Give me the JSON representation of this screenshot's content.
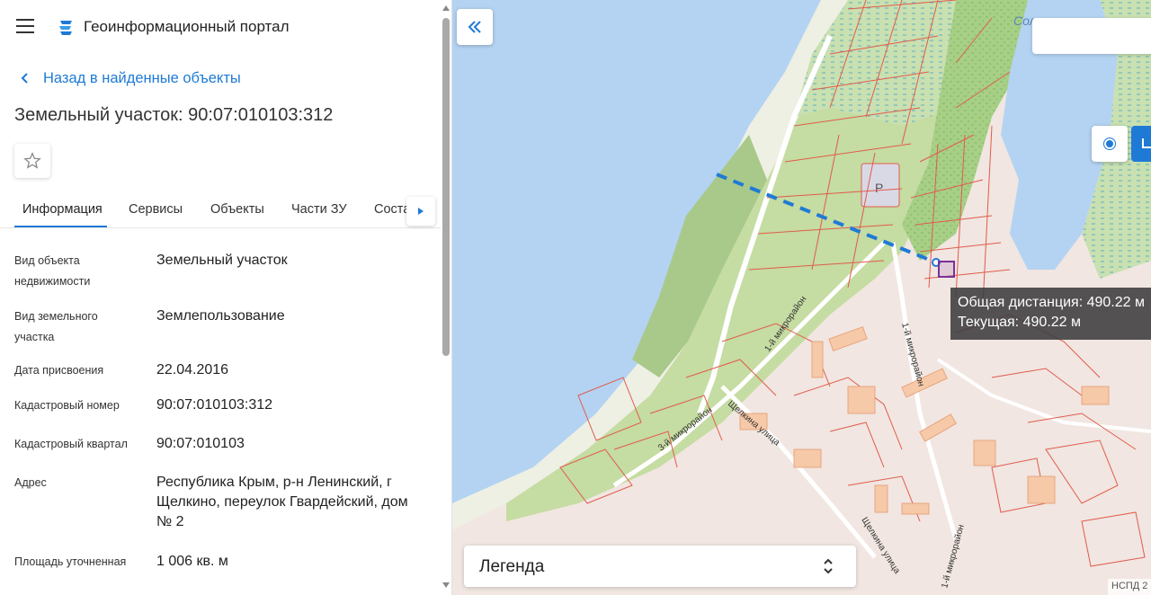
{
  "app": {
    "title": "Геоинформационный портал",
    "icons": {
      "menu": "hamburger-menu-icon",
      "logo": "portal-logo-icon"
    }
  },
  "nav": {
    "back_label": "Назад в найденные объекты"
  },
  "object": {
    "title": "Земельный участок: 90:07:010103:312"
  },
  "tabs": [
    {
      "label": "Информация",
      "active": true
    },
    {
      "label": "Сервисы"
    },
    {
      "label": "Объекты"
    },
    {
      "label": "Части ЗУ"
    },
    {
      "label": "Соста"
    }
  ],
  "properties": [
    {
      "label": "Вид объекта недвижимости",
      "value": "Земельный участок"
    },
    {
      "label": "Вид земельного участка",
      "value": "Землепользование"
    },
    {
      "label": "Дата присвоения",
      "value": "22.04.2016"
    },
    {
      "label": "Кадастровый номер",
      "value": "90:07:010103:312"
    },
    {
      "label": "Кадастровый квартал",
      "value": "90:07:010103"
    },
    {
      "label": "Адрес",
      "value": "Республика Крым, р-н Ленинский, г Щелкино, переулок Гвардейский, дом № 2"
    },
    {
      "label": "Площадь уточненная",
      "value": "1 006 кв. м"
    }
  ],
  "map": {
    "lake_label": "Сол оз",
    "parking_label": "P",
    "streets": [
      "1-й микрорайон",
      "1-й микрорайон",
      "3-й микрорайон",
      "Щелкина улица",
      "Щелкина улица",
      "1-й микрорайон"
    ],
    "measure": {
      "total": "Общая дистанция: 490.22 м",
      "current": "Текущая: 490.22 м"
    },
    "legend_label": "Легенда",
    "attribution": "НСПД 2",
    "colors": {
      "water": "#b4d3f2",
      "park": "#c5dca2",
      "forest": "#9fcb7e",
      "urban": "#f3d9d2",
      "parcel_line": "#e15b4c",
      "measure_line": "#1f7ad6",
      "selected_parcel": "#7a2f9b"
    }
  }
}
